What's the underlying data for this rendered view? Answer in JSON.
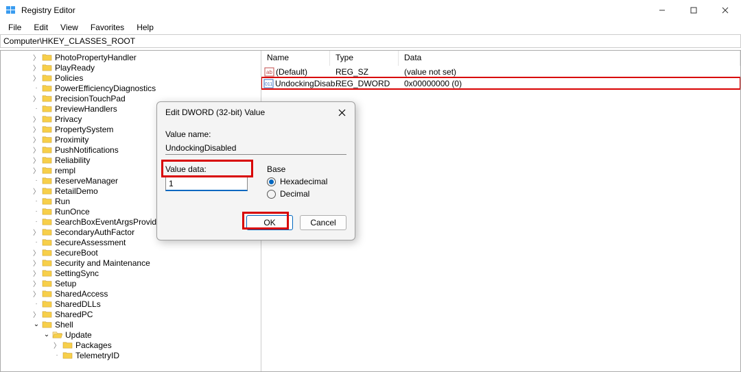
{
  "window": {
    "title": "Registry Editor",
    "minimize": "—",
    "maximize": "▢",
    "close": "✕"
  },
  "menu": {
    "file": "File",
    "edit": "Edit",
    "view": "View",
    "favorites": "Favorites",
    "help": "Help"
  },
  "address": "Computer\\HKEY_CLASSES_ROOT",
  "tree": {
    "items": [
      {
        "label": "PhotoPropertyHandler",
        "depth": 3,
        "chevron": "right"
      },
      {
        "label": "PlayReady",
        "depth": 3,
        "chevron": "right"
      },
      {
        "label": "Policies",
        "depth": 3,
        "chevron": "right"
      },
      {
        "label": "PowerEfficiencyDiagnostics",
        "depth": 3,
        "chevron": "none"
      },
      {
        "label": "PrecisionTouchPad",
        "depth": 3,
        "chevron": "right"
      },
      {
        "label": "PreviewHandlers",
        "depth": 3,
        "chevron": "none"
      },
      {
        "label": "Privacy",
        "depth": 3,
        "chevron": "right"
      },
      {
        "label": "PropertySystem",
        "depth": 3,
        "chevron": "right"
      },
      {
        "label": "Proximity",
        "depth": 3,
        "chevron": "right"
      },
      {
        "label": "PushNotifications",
        "depth": 3,
        "chevron": "right"
      },
      {
        "label": "Reliability",
        "depth": 3,
        "chevron": "right"
      },
      {
        "label": "rempl",
        "depth": 3,
        "chevron": "right"
      },
      {
        "label": "ReserveManager",
        "depth": 3,
        "chevron": "none"
      },
      {
        "label": "RetailDemo",
        "depth": 3,
        "chevron": "right"
      },
      {
        "label": "Run",
        "depth": 3,
        "chevron": "none"
      },
      {
        "label": "RunOnce",
        "depth": 3,
        "chevron": "none"
      },
      {
        "label": "SearchBoxEventArgsProvider",
        "depth": 3,
        "chevron": "none"
      },
      {
        "label": "SecondaryAuthFactor",
        "depth": 3,
        "chevron": "right"
      },
      {
        "label": "SecureAssessment",
        "depth": 3,
        "chevron": "none"
      },
      {
        "label": "SecureBoot",
        "depth": 3,
        "chevron": "right"
      },
      {
        "label": "Security and Maintenance",
        "depth": 3,
        "chevron": "right"
      },
      {
        "label": "SettingSync",
        "depth": 3,
        "chevron": "right"
      },
      {
        "label": "Setup",
        "depth": 3,
        "chevron": "right"
      },
      {
        "label": "SharedAccess",
        "depth": 3,
        "chevron": "right"
      },
      {
        "label": "SharedDLLs",
        "depth": 3,
        "chevron": "none"
      },
      {
        "label": "SharedPC",
        "depth": 3,
        "chevron": "right"
      },
      {
        "label": "Shell",
        "depth": 3,
        "chevron": "down"
      },
      {
        "label": "Update",
        "depth": 4,
        "chevron": "down",
        "open": true
      },
      {
        "label": "Packages",
        "depth": 5,
        "chevron": "right"
      },
      {
        "label": "TelemetryID",
        "depth": 5,
        "chevron": "none"
      }
    ]
  },
  "list": {
    "headers": {
      "name": "Name",
      "type": "Type",
      "data": "Data"
    },
    "rows": [
      {
        "icon": "string",
        "name": "(Default)",
        "type": "REG_SZ",
        "data": "(value not set)",
        "highlight": false
      },
      {
        "icon": "dword",
        "name": "UndockingDisab...",
        "type": "REG_DWORD",
        "data": "0x00000000 (0)",
        "highlight": true
      }
    ]
  },
  "dialog": {
    "title": "Edit DWORD (32-bit) Value",
    "value_name_label": "Value name:",
    "value_name": "UndockingDisabled",
    "value_data_label": "Value data:",
    "value_data": "1",
    "base_label": "Base",
    "base_hex": "Hexadecimal",
    "base_dec": "Decimal",
    "ok": "OK",
    "cancel": "Cancel"
  }
}
